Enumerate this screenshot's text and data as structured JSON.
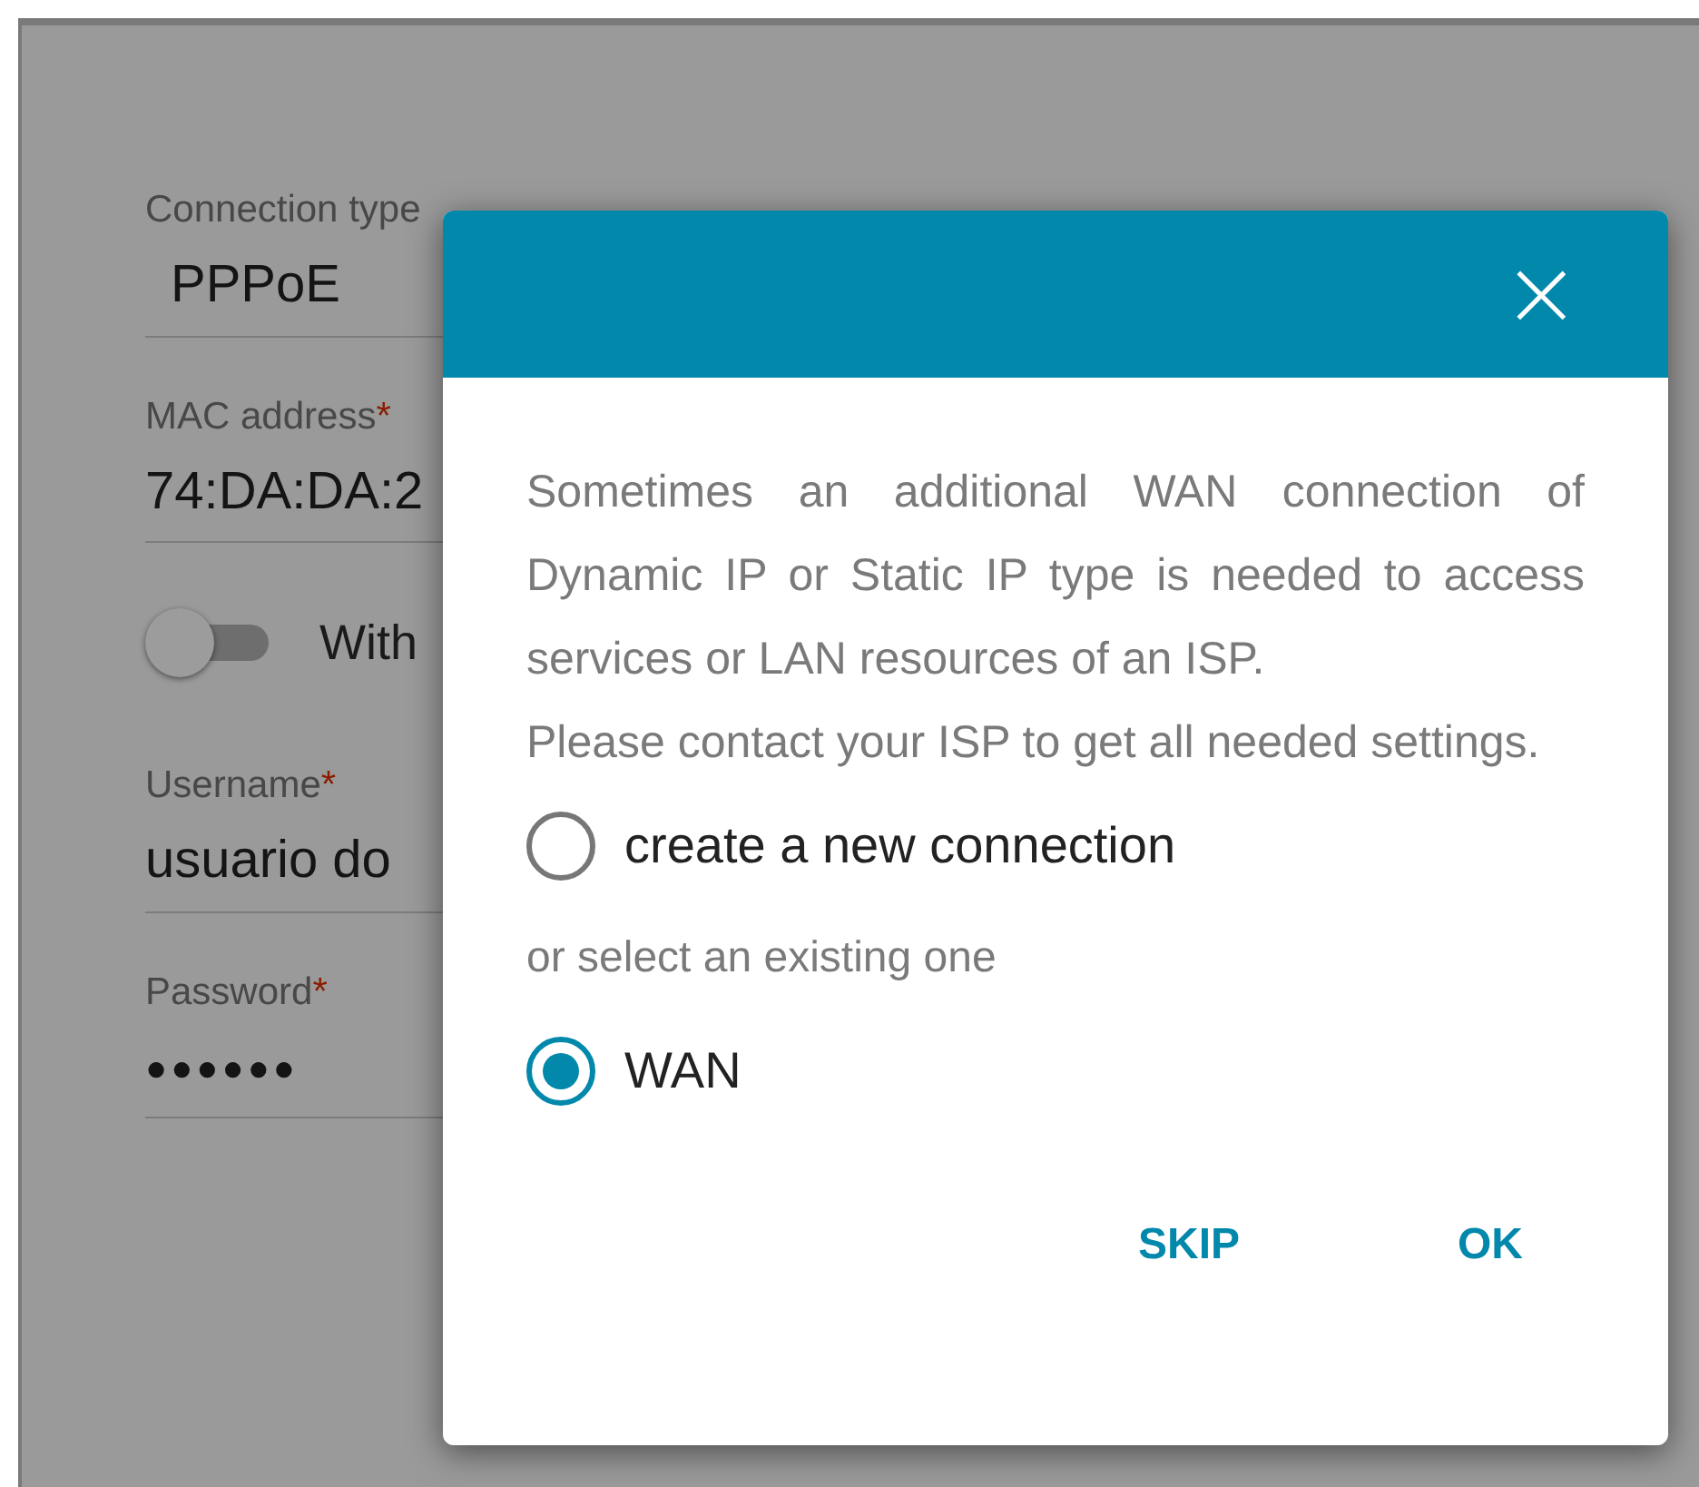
{
  "form": {
    "fields": [
      {
        "kind": "text",
        "label": "Connection type",
        "value": "PPPoE"
      },
      {
        "kind": "text",
        "label": "MAC address",
        "mark": "*",
        "value": "74:DA:DA:2"
      },
      {
        "kind": "switch",
        "label": "With",
        "on": false
      },
      {
        "kind": "text",
        "label": "Username",
        "mark": "*",
        "value": "usuario do"
      },
      {
        "kind": "text",
        "label": "Password",
        "mark": "*",
        "value": "●●●●●●"
      }
    ]
  },
  "dialog": {
    "close": "×",
    "paragraphs": [
      "Sometimes an additional WAN connection of Dynamic IP or Static IP type is needed to access services or LAN resources of an ISP.",
      "Please contact your ISP to get all needed settings."
    ],
    "options": [
      {
        "kind": "radio",
        "label": "create a new connection",
        "selected": false
      },
      {
        "kind": "note",
        "label": "or select an existing one"
      },
      {
        "kind": "radio",
        "label": "WAN",
        "selected": true
      }
    ],
    "buttons": [
      "SKIP",
      "OK"
    ]
  }
}
